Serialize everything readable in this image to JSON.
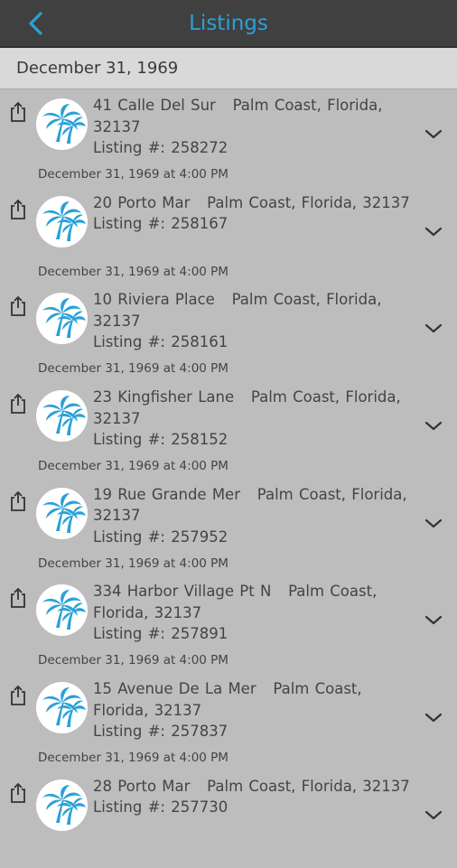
{
  "header": {
    "title": "Listings",
    "back_icon": "chevron-left-icon",
    "accent_color": "#2aa1d6"
  },
  "section": {
    "date": "December 31, 1969"
  },
  "listings": [
    {
      "address": "41 Calle Del Sur",
      "city": "Palm Coast, Florida, 32137",
      "listing_label": "Listing #: 258272",
      "timestamp": "December 31, 1969 at 4:00 PM"
    },
    {
      "address": "20 Porto Mar",
      "city": "Palm Coast, Florida, 32137",
      "listing_label": "Listing #: 258167",
      "timestamp": "December 31, 1969 at 4:00 PM"
    },
    {
      "address": "10 Riviera Place",
      "city": "Palm Coast, Florida, 32137",
      "listing_label": "Listing #: 258161",
      "timestamp": "December 31, 1969 at 4:00 PM"
    },
    {
      "address": "23 Kingfisher Lane",
      "city": "Palm Coast, Florida, 32137",
      "listing_label": "Listing #: 258152",
      "timestamp": "December 31, 1969 at 4:00 PM"
    },
    {
      "address": "19 Rue Grande Mer",
      "city": "Palm Coast, Florida, 32137",
      "listing_label": "Listing #: 257952",
      "timestamp": "December 31, 1969 at 4:00 PM"
    },
    {
      "address": "334 Harbor Village Pt N",
      "city": "Palm Coast, Florida, 32137",
      "listing_label": "Listing #: 257891",
      "timestamp": "December 31, 1969 at 4:00 PM"
    },
    {
      "address": "15 Avenue De La Mer",
      "city": "Palm Coast, Florida, 32137",
      "listing_label": "Listing #: 257837",
      "timestamp": "December 31, 1969 at 4:00 PM"
    },
    {
      "address": "28 Porto Mar",
      "city": "Palm Coast, Florida, 32137",
      "listing_label": "Listing #: 257730",
      "timestamp": ""
    }
  ],
  "icons": {
    "share": "share-icon",
    "logo": "palm-tree-logo-icon",
    "expand": "chevron-down-icon"
  }
}
